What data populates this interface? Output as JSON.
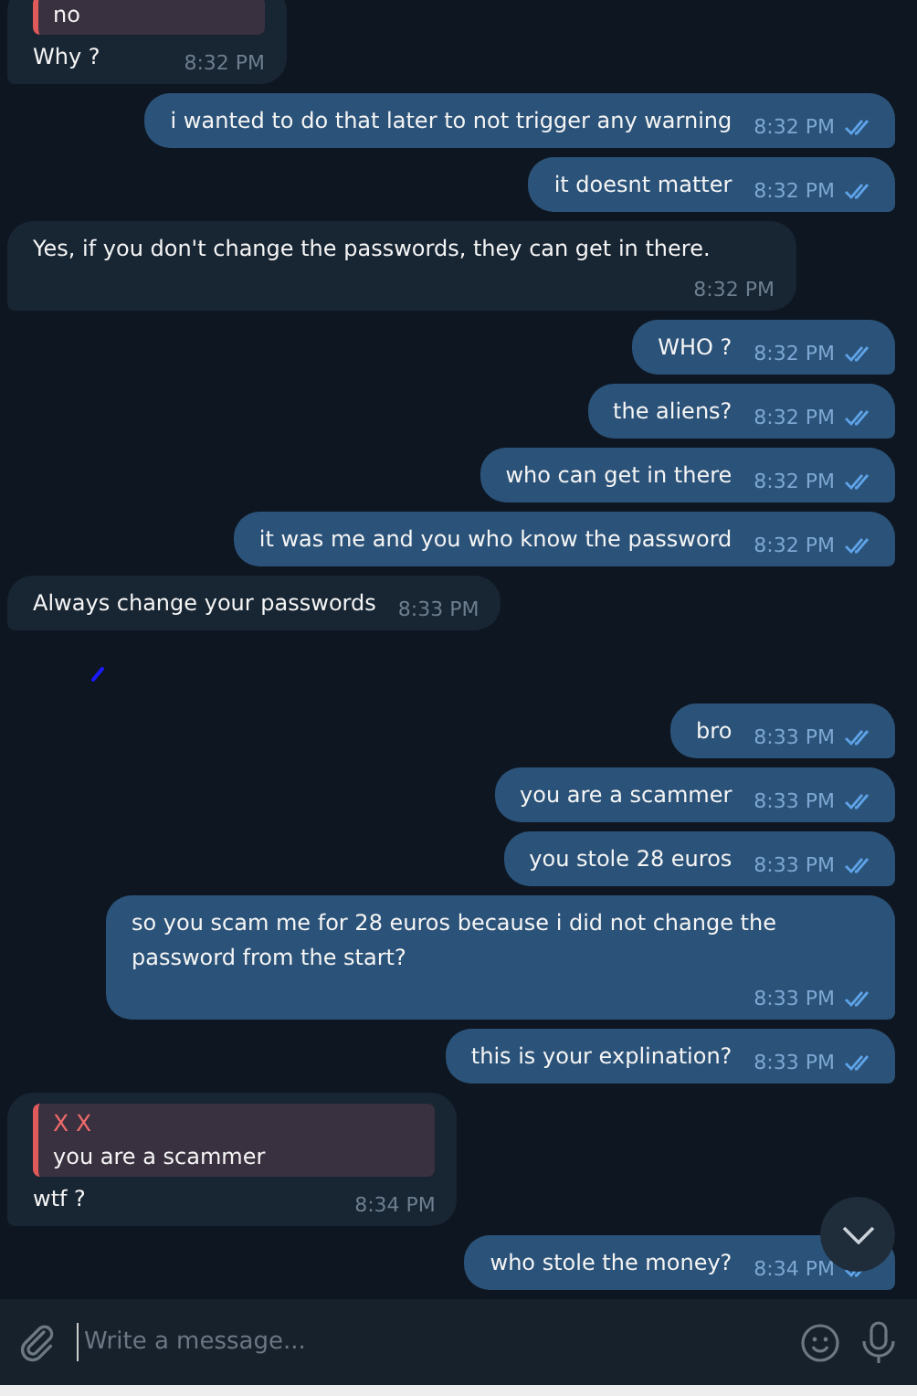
{
  "messages": [
    {
      "kind": "in",
      "reply": {
        "text": "no"
      },
      "text": "Why ?",
      "time": "8:32 PM"
    },
    {
      "kind": "out",
      "text": "i wanted to do that later to not trigger any  warning",
      "time": "8:32 PM",
      "read": true
    },
    {
      "kind": "out",
      "text": "it doesnt matter",
      "time": "8:32 PM",
      "read": true
    },
    {
      "kind": "in",
      "text": "Yes, if you don't change the passwords, they can get in there.",
      "time": "8:32 PM"
    },
    {
      "kind": "out",
      "text": "WHO ?",
      "time": "8:32 PM",
      "read": true
    },
    {
      "kind": "out",
      "text": "the aliens?",
      "time": "8:32 PM",
      "read": true
    },
    {
      "kind": "out",
      "text": "who can get in there",
      "time": "8:32 PM",
      "read": true
    },
    {
      "kind": "out",
      "text": "it was me and you who know the password",
      "time": "8:32 PM",
      "read": true
    },
    {
      "kind": "in",
      "text": "Always change your passwords",
      "time": "8:33 PM"
    },
    {
      "kind": "mark"
    },
    {
      "kind": "out",
      "text": "bro",
      "time": "8:33 PM",
      "read": true
    },
    {
      "kind": "out",
      "text": "you are a scammer",
      "time": "8:33 PM",
      "read": true
    },
    {
      "kind": "out",
      "text": "you stole 28 euros",
      "time": "8:33 PM",
      "read": true
    },
    {
      "kind": "out",
      "text": "so you scam me for 28 euros because i did not change the password from the start?",
      "time": "8:33 PM",
      "read": true
    },
    {
      "kind": "out",
      "text": "this is your explination?",
      "time": "8:33 PM",
      "read": true
    },
    {
      "kind": "in",
      "reply": {
        "author": "X X",
        "text": "you are a scammer"
      },
      "text": "wtf ?",
      "time": "8:34 PM"
    },
    {
      "kind": "out",
      "text": "who stole the money?",
      "time": "8:34 PM",
      "read": true
    }
  ],
  "composer": {
    "placeholder": "Write a message..."
  }
}
